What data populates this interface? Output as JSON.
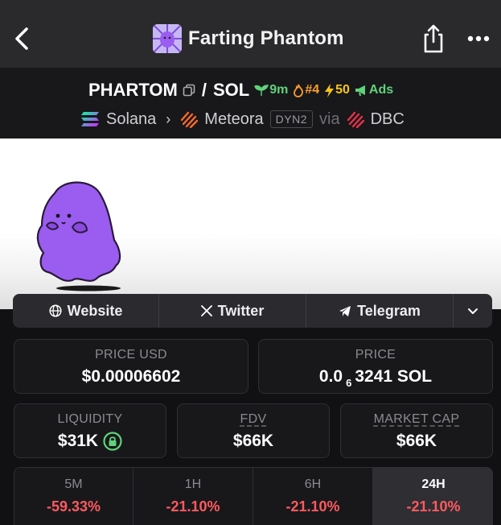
{
  "window": {
    "title": "Farting Phantom"
  },
  "pair": {
    "base": "PHARTOM",
    "separator": "/",
    "quote": "SOL",
    "age": "9m",
    "rank": "#4",
    "boost": "50",
    "ads": "Ads",
    "chain": "Solana",
    "dex": "Meteora",
    "dex_tag": "DYN2",
    "via": "via",
    "launchpad": "DBC"
  },
  "links": {
    "website": "Website",
    "twitter": "Twitter",
    "telegram": "Telegram"
  },
  "stats": {
    "price_usd_label": "PRICE USD",
    "price_usd": "$0.00006602",
    "price_label": "PRICE",
    "price_prefix": "0.0",
    "price_zero_count": "6",
    "price_rest": "3241 SOL",
    "liquidity_label": "LIQUIDITY",
    "liquidity": "$31K",
    "fdv_label": "FDV",
    "fdv": "$66K",
    "mcap_label": "MARKET CAP",
    "mcap": "$66K"
  },
  "timeframes": [
    {
      "label": "5M",
      "change": "-59.33%"
    },
    {
      "label": "1H",
      "change": "-21.10%"
    },
    {
      "label": "6H",
      "change": "-21.10%"
    },
    {
      "label": "24H",
      "change": "-21.10%"
    }
  ],
  "colors": {
    "green": "#5fd27a",
    "orange": "#ff9f2e",
    "yellow": "#f5c518",
    "negative": "#ff5a5f"
  },
  "icons": [
    "back-arrow-icon",
    "share-icon",
    "more-dots-icon",
    "copy-icon",
    "sprout-icon",
    "flame-icon",
    "bolt-icon",
    "megaphone-icon",
    "solana-icon",
    "meteora-icon",
    "dbc-icon",
    "globe-icon",
    "x-icon",
    "telegram-icon",
    "chevron-down-icon",
    "lock-icon"
  ]
}
